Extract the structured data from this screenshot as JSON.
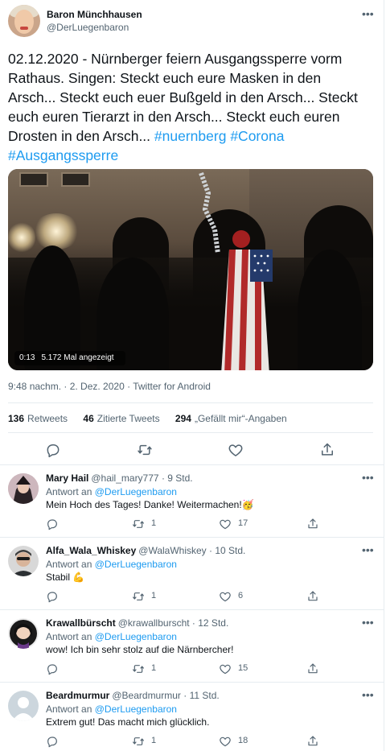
{
  "main_tweet": {
    "display_name": "Baron Münchhausen",
    "handle": "@DerLuegenbaron",
    "text_plain": "02.12.2020 - Nürnberger feiern Ausgangssperre vorm Rathaus. Singen: Steckt euch eure Masken in den Arsch... Steckt euch euer Bußgeld in den Arsch... Steckt euch euren Tierarzt in den Arsch... Steckt euch euren Drosten in den Arsch...",
    "hashtags": [
      "#nuernberg",
      "#Corona",
      "#Ausgangssperre"
    ],
    "video": {
      "duration": "0:13",
      "views": "5.172 Mal angezeigt"
    },
    "timestamp": "9:48 nachm. · 2. Dez. 2020 · Twitter for Android",
    "stats": {
      "retweets_count": "136",
      "retweets_label": "Retweets",
      "quotes_count": "46",
      "quotes_label": "Zitierte Tweets",
      "likes_count": "294",
      "likes_label": "„Gefällt mir“-Angaben"
    }
  },
  "replies": [
    {
      "display_name": "Mary Hail",
      "handle": "@hail_mary777",
      "time": "· 9 Std.",
      "reply_prefix": "Antwort an",
      "reply_to": "@DerLuegenbaron",
      "text": "Mein Hoch des Tages! Danke! Weitermachen!",
      "emoji": "🥳",
      "retweets": "1",
      "likes": "17"
    },
    {
      "display_name": "Alfa_Wala_Whiskey",
      "handle": "@WalaWhiskey",
      "time": "· 10 Std.",
      "reply_prefix": "Antwort an",
      "reply_to": "@DerLuegenbaron",
      "text": "Stabil",
      "emoji": "💪",
      "retweets": "1",
      "likes": "6"
    },
    {
      "display_name": "Krawallbürscht",
      "handle": "@krawallburscht",
      "time": "· 12 Std.",
      "reply_prefix": "Antwort an",
      "reply_to": "@DerLuegenbaron",
      "text": "wow! Ich bin sehr stolz auf die Närnbercher!",
      "emoji": "",
      "retweets": "1",
      "likes": "15"
    },
    {
      "display_name": "Beardmurmur",
      "handle": "@Beardmurmur",
      "time": "· 11 Std.",
      "reply_prefix": "Antwort an",
      "reply_to": "@DerLuegenbaron",
      "text": "Extrem gut! Das macht mich glücklich.",
      "emoji": "",
      "retweets": "1",
      "likes": "18"
    }
  ],
  "icons": {
    "more": "more-dots-icon",
    "reply": "reply-icon",
    "retweet": "retweet-icon",
    "like": "like-icon",
    "share": "share-icon"
  },
  "colors": {
    "link": "#1d9bf0",
    "text": "#0f1419",
    "secondary": "#536471",
    "border": "#e6ecf0"
  }
}
